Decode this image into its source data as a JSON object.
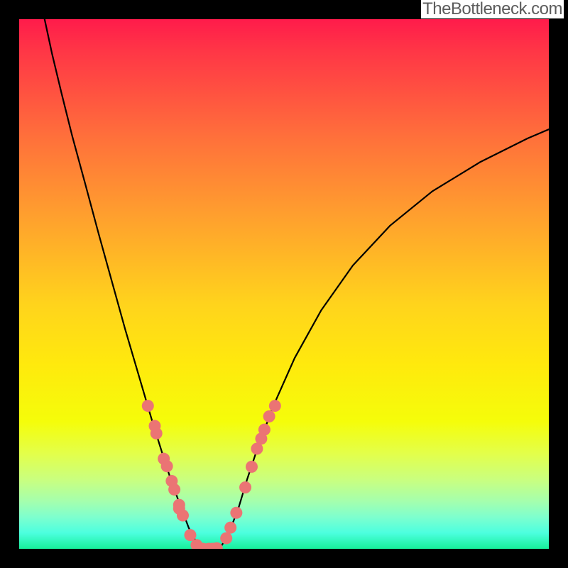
{
  "attribution": "TheBottleneck.com",
  "chart_data": {
    "type": "line",
    "title": "",
    "xlabel": "",
    "ylabel": "",
    "xlim": [
      0,
      100
    ],
    "ylim": [
      0,
      100
    ],
    "gradient_stops": [
      {
        "pct": 0,
        "color": "#ff1b4b"
      },
      {
        "pct": 6,
        "color": "#ff3646"
      },
      {
        "pct": 22,
        "color": "#ff6f3b"
      },
      {
        "pct": 37,
        "color": "#ff9f2e"
      },
      {
        "pct": 54,
        "color": "#ffd41c"
      },
      {
        "pct": 65,
        "color": "#ffe90d"
      },
      {
        "pct": 76,
        "color": "#f5fd0a"
      },
      {
        "pct": 82,
        "color": "#e3ff4a"
      },
      {
        "pct": 87,
        "color": "#c9ff80"
      },
      {
        "pct": 91,
        "color": "#a5ffad"
      },
      {
        "pct": 94,
        "color": "#7effce"
      },
      {
        "pct": 97,
        "color": "#4cffdf"
      },
      {
        "pct": 100,
        "color": "#17f09a"
      }
    ],
    "series": [
      {
        "name": "bottleneck-curve",
        "xy": [
          [
            4.8,
            100.0
          ],
          [
            6.2,
            93.5
          ],
          [
            8.0,
            86.0
          ],
          [
            10.0,
            78.0
          ],
          [
            12.5,
            68.8
          ],
          [
            15.0,
            59.5
          ],
          [
            17.5,
            50.5
          ],
          [
            20.0,
            41.5
          ],
          [
            22.5,
            33.0
          ],
          [
            25.0,
            24.5
          ],
          [
            27.5,
            16.5
          ],
          [
            29.0,
            12.0
          ],
          [
            30.5,
            8.0
          ],
          [
            32.0,
            4.0
          ],
          [
            33.0,
            2.0
          ],
          [
            34.0,
            0.8
          ],
          [
            35.0,
            0.2
          ],
          [
            36.5,
            0.0
          ],
          [
            38.0,
            0.3
          ],
          [
            39.0,
            1.8
          ],
          [
            40.0,
            4.0
          ],
          [
            41.5,
            8.0
          ],
          [
            43.0,
            13.0
          ],
          [
            45.0,
            19.0
          ],
          [
            48.0,
            27.0
          ],
          [
            52.0,
            36.0
          ],
          [
            57.0,
            45.0
          ],
          [
            63.0,
            53.5
          ],
          [
            70.0,
            61.0
          ],
          [
            78.0,
            67.5
          ],
          [
            87.0,
            73.0
          ],
          [
            96.0,
            77.5
          ],
          [
            100.0,
            79.2
          ]
        ]
      },
      {
        "name": "marker-dots",
        "xy": [
          [
            24.3,
            27.0
          ],
          [
            25.6,
            23.2
          ],
          [
            25.9,
            21.8
          ],
          [
            27.3,
            17.0
          ],
          [
            27.9,
            15.6
          ],
          [
            28.8,
            12.8
          ],
          [
            29.3,
            11.2
          ],
          [
            30.2,
            8.3
          ],
          [
            30.2,
            7.6
          ],
          [
            30.9,
            6.3
          ],
          [
            32.3,
            2.6
          ],
          [
            33.5,
            0.7
          ],
          [
            34.7,
            0.0
          ],
          [
            35.8,
            0.0
          ],
          [
            36.5,
            0.0
          ],
          [
            37.3,
            0.1
          ],
          [
            39.1,
            2.0
          ],
          [
            39.9,
            4.0
          ],
          [
            41.0,
            6.8
          ],
          [
            42.7,
            11.6
          ],
          [
            43.9,
            15.5
          ],
          [
            44.9,
            18.9
          ],
          [
            45.7,
            20.8
          ],
          [
            46.3,
            22.5
          ],
          [
            47.2,
            25.0
          ],
          [
            48.3,
            27.0
          ]
        ]
      }
    ]
  }
}
